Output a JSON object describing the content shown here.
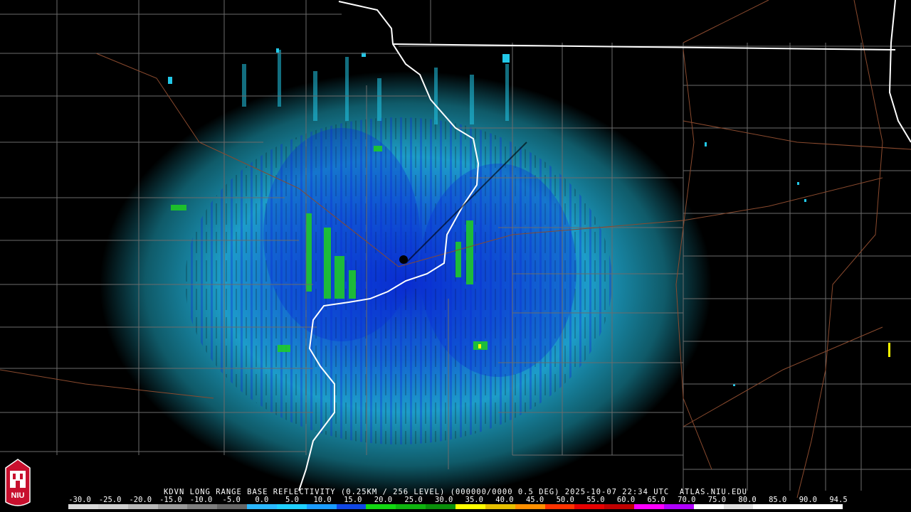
{
  "product": {
    "title": "KDVN LONG RANGE BASE REFLECTIVITY (0.25KM / 256 LEVEL) (000000/0000 0.5 DEG) 2025-10-07 22:34 UTC  ATLAS.NIU.EDU"
  },
  "logo": {
    "text": "NIU",
    "icon": "niu-tower-logo"
  },
  "legend": {
    "labels": [
      "-30.0",
      "-25.0",
      "-20.0",
      "-15.0",
      "-10.0",
      "-5.0",
      "0.0",
      "5.0",
      "10.0",
      "15.0",
      "20.0",
      "25.0",
      "30.0",
      "35.0",
      "40.0",
      "45.0",
      "50.0",
      "55.0",
      "60.0",
      "65.0",
      "70.0",
      "75.0",
      "80.0",
      "85.0",
      "90.0",
      "94.5"
    ],
    "colors": [
      "#d9d9d9",
      "#cfcfcf",
      "#b8b8b8",
      "#9a9a9a",
      "#7f7f7f",
      "#666666",
      "#2ab8ff",
      "#1fd0ff",
      "#1a9cff",
      "#1047e6",
      "#12d812",
      "#0fb40f",
      "#0a8f0a",
      "#ffff00",
      "#e6c000",
      "#ff9000",
      "#ff3300",
      "#e60000",
      "#c00000",
      "#ff00ff",
      "#b000ff",
      "#ffffff",
      "#e0e0e0",
      "#ffffff",
      "#ffffff",
      "#ffffff"
    ]
  },
  "map": {
    "radar_site": "KDVN",
    "colors": {
      "background": "#000000",
      "county_lines": "#6b6b6b",
      "state_lines": "#ffffff",
      "roads": "#8a4a2e",
      "echo_light": "#22c8e8",
      "echo_mid": "#1a8cf0",
      "echo_dense": "#0a2ed8",
      "echo_green": "#20d020"
    }
  }
}
